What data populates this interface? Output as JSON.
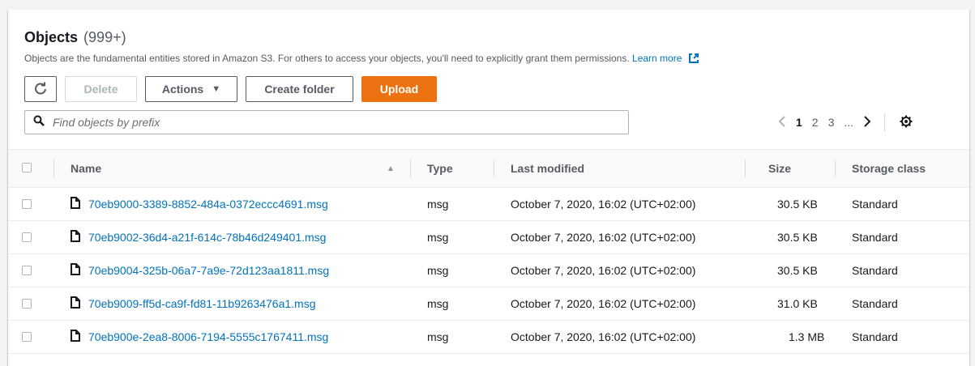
{
  "header": {
    "title": "Objects",
    "count": "(999+)",
    "description": "Objects are the fundamental entities stored in Amazon S3. For others to access your objects, you'll need to explicitly grant them permissions.",
    "learn_more": "Learn more"
  },
  "toolbar": {
    "delete_label": "Delete",
    "actions_label": "Actions",
    "create_folder_label": "Create folder",
    "upload_label": "Upload"
  },
  "search": {
    "placeholder": "Find objects by prefix",
    "value": ""
  },
  "pagination": {
    "pages": [
      "1",
      "2",
      "3"
    ],
    "ellipsis": "...",
    "current_page": "1"
  },
  "table": {
    "columns": [
      "Name",
      "Type",
      "Last modified",
      "Size",
      "Storage class"
    ],
    "sorted_column": "Name",
    "sort_direction": "ascending",
    "rows": [
      {
        "name": "70eb9000-3389-8852-484a-0372eccc4691.msg",
        "type": "msg",
        "last_modified": "October 7, 2020, 16:02 (UTC+02:00)",
        "size": "30.5 KB",
        "storage_class": "Standard"
      },
      {
        "name": "70eb9002-36d4-a21f-614c-78b46d249401.msg",
        "type": "msg",
        "last_modified": "October 7, 2020, 16:02 (UTC+02:00)",
        "size": "30.5 KB",
        "storage_class": "Standard"
      },
      {
        "name": "70eb9004-325b-06a7-7a9e-72d123aa1811.msg",
        "type": "msg",
        "last_modified": "October 7, 2020, 16:02 (UTC+02:00)",
        "size": "30.5 KB",
        "storage_class": "Standard"
      },
      {
        "name": "70eb9009-ff5d-ca9f-fd81-11b9263476a1.msg",
        "type": "msg",
        "last_modified": "October 7, 2020, 16:02 (UTC+02:00)",
        "size": "31.0 KB",
        "storage_class": "Standard"
      },
      {
        "name": "70eb900e-2ea8-8006-7194-5555c1767411.msg",
        "type": "msg",
        "last_modified": "October 7, 2020, 16:02 (UTC+02:00)",
        "size": "1.3 MB",
        "storage_class": "Standard"
      }
    ]
  },
  "icons": {
    "refresh": "refresh-icon",
    "caret": "caret-down-icon",
    "search": "search-icon",
    "external": "external-link-icon",
    "prev": "chevron-left-icon",
    "next": "chevron-right-icon",
    "settings": "gear-icon",
    "sort": "sort-ascending-icon",
    "file": "file-icon"
  },
  "colors": {
    "primary": "#ec7211",
    "link": "#0073bb",
    "text": "#16191f",
    "muted": "#545b64"
  }
}
